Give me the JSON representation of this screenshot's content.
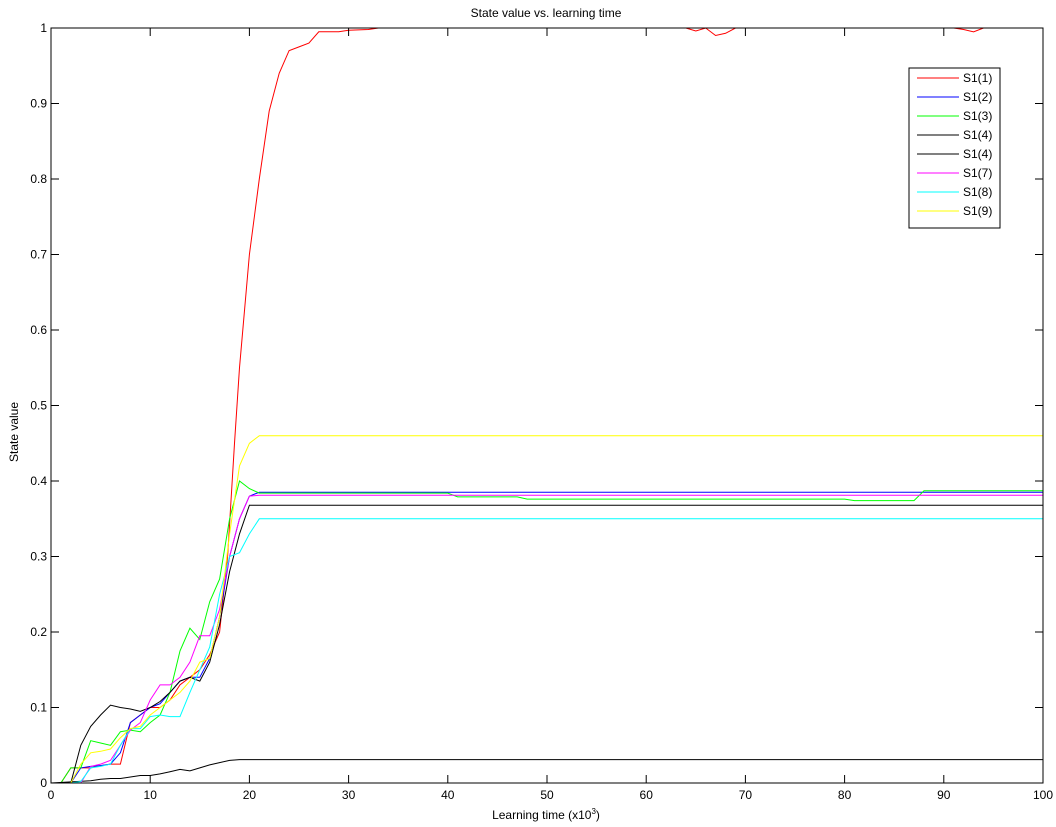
{
  "chart_data": {
    "type": "line",
    "title": "State value vs. learning time",
    "xlabel_prefix": "Learning time (x10",
    "xlabel_sup": "3",
    "xlabel_suffix": ")",
    "ylabel": "State value",
    "xlim": [
      0,
      100
    ],
    "ylim": [
      0,
      1
    ],
    "xticks": [
      0,
      10,
      20,
      30,
      40,
      50,
      60,
      70,
      80,
      90,
      100
    ],
    "yticks": [
      0,
      0.1,
      0.2,
      0.3,
      0.4,
      0.5,
      0.6,
      0.7,
      0.8,
      0.9,
      1
    ],
    "grid": false,
    "legend_position": "top-right",
    "series": [
      {
        "name": "S1(1)",
        "color": "#ff0000",
        "points": [
          [
            1,
            0
          ],
          [
            2,
            0.02
          ],
          [
            3,
            0.02
          ],
          [
            4,
            0.02
          ],
          [
            5,
            0.023
          ],
          [
            6,
            0.025
          ],
          [
            7,
            0.025
          ],
          [
            8,
            0.08
          ],
          [
            9,
            0.09
          ],
          [
            10,
            0.1
          ],
          [
            11,
            0.1
          ],
          [
            12,
            0.11
          ],
          [
            13,
            0.13
          ],
          [
            14,
            0.14
          ],
          [
            15,
            0.15
          ],
          [
            16,
            0.17
          ],
          [
            17,
            0.2
          ],
          [
            17.8,
            0.3
          ],
          [
            18.5,
            0.45
          ],
          [
            19,
            0.55
          ],
          [
            20,
            0.7
          ],
          [
            21,
            0.8
          ],
          [
            22,
            0.89
          ],
          [
            23,
            0.94
          ],
          [
            24,
            0.97
          ],
          [
            25,
            0.975
          ],
          [
            26,
            0.98
          ],
          [
            27,
            0.995
          ],
          [
            28,
            0.995
          ],
          [
            29,
            0.995
          ],
          [
            30,
            0.997
          ],
          [
            32,
            0.998
          ],
          [
            33,
            1
          ],
          [
            64,
            1
          ],
          [
            65,
            0.996
          ],
          [
            66,
            1
          ],
          [
            67,
            0.99
          ],
          [
            68,
            0.993
          ],
          [
            69,
            1
          ],
          [
            70,
            1
          ],
          [
            91,
            1
          ],
          [
            92,
            0.998
          ],
          [
            93,
            0.995
          ],
          [
            94,
            1
          ],
          [
            100,
            1
          ]
        ]
      },
      {
        "name": "S1(2)",
        "color": "#0000ff",
        "points": [
          [
            2,
            0
          ],
          [
            3,
            0.02
          ],
          [
            4,
            0.022
          ],
          [
            5,
            0.023
          ],
          [
            6,
            0.025
          ],
          [
            7,
            0.04
          ],
          [
            8,
            0.08
          ],
          [
            9,
            0.09
          ],
          [
            10,
            0.1
          ],
          [
            11,
            0.105
          ],
          [
            12,
            0.12
          ],
          [
            13,
            0.135
          ],
          [
            14,
            0.14
          ],
          [
            15,
            0.14
          ],
          [
            16,
            0.165
          ],
          [
            17,
            0.22
          ],
          [
            18,
            0.3
          ],
          [
            19,
            0.35
          ],
          [
            20,
            0.38
          ],
          [
            21,
            0.385
          ],
          [
            40,
            0.385
          ],
          [
            100,
            0.385
          ]
        ]
      },
      {
        "name": "S1(3)",
        "color": "#00ff00",
        "points": [
          [
            1,
            0
          ],
          [
            2,
            0.02
          ],
          [
            3,
            0.02
          ],
          [
            4,
            0.056
          ],
          [
            5,
            0.053
          ],
          [
            6,
            0.05
          ],
          [
            7,
            0.068
          ],
          [
            8,
            0.07
          ],
          [
            9,
            0.068
          ],
          [
            10,
            0.08
          ],
          [
            11,
            0.09
          ],
          [
            12,
            0.12
          ],
          [
            13,
            0.175
          ],
          [
            14,
            0.205
          ],
          [
            15,
            0.19
          ],
          [
            16,
            0.24
          ],
          [
            17,
            0.27
          ],
          [
            18,
            0.35
          ],
          [
            19,
            0.4
          ],
          [
            20,
            0.39
          ],
          [
            21,
            0.384
          ],
          [
            40,
            0.384
          ],
          [
            41,
            0.379
          ],
          [
            47,
            0.379
          ],
          [
            48,
            0.376
          ],
          [
            80,
            0.376
          ],
          [
            81,
            0.374
          ],
          [
            87,
            0.374
          ],
          [
            88,
            0.387
          ],
          [
            100,
            0.387
          ]
        ]
      },
      {
        "name": "S1(4)",
        "color": "#000000",
        "points": [
          [
            0,
            0
          ],
          [
            4,
            0.003
          ],
          [
            5,
            0.005
          ],
          [
            6,
            0.006
          ],
          [
            7,
            0.006
          ],
          [
            8,
            0.008
          ],
          [
            9,
            0.01
          ],
          [
            10,
            0.01
          ],
          [
            11,
            0.012
          ],
          [
            12,
            0.015
          ],
          [
            13,
            0.018
          ],
          [
            14,
            0.016
          ],
          [
            15,
            0.02
          ],
          [
            16,
            0.024
          ],
          [
            17,
            0.027
          ],
          [
            18,
            0.03
          ],
          [
            19,
            0.031
          ],
          [
            100,
            0.031
          ]
        ]
      },
      {
        "name": "S1(4)",
        "color": "#000000",
        "points": [
          [
            2,
            0
          ],
          [
            3,
            0.05
          ],
          [
            4,
            0.075
          ],
          [
            5,
            0.09
          ],
          [
            6,
            0.103
          ],
          [
            7,
            0.1
          ],
          [
            8,
            0.098
          ],
          [
            9,
            0.095
          ],
          [
            10,
            0.1
          ],
          [
            11,
            0.108
          ],
          [
            12,
            0.12
          ],
          [
            13,
            0.135
          ],
          [
            14,
            0.14
          ],
          [
            15,
            0.135
          ],
          [
            16,
            0.16
          ],
          [
            17,
            0.21
          ],
          [
            18,
            0.28
          ],
          [
            19,
            0.33
          ],
          [
            20,
            0.368
          ],
          [
            100,
            0.368
          ]
        ]
      },
      {
        "name": "S1(7)",
        "color": "#ff00ff",
        "points": [
          [
            3,
            0
          ],
          [
            4,
            0.022
          ],
          [
            5,
            0.025
          ],
          [
            6,
            0.03
          ],
          [
            7,
            0.05
          ],
          [
            8,
            0.07
          ],
          [
            9,
            0.08
          ],
          [
            10,
            0.11
          ],
          [
            11,
            0.13
          ],
          [
            12,
            0.13
          ],
          [
            13,
            0.14
          ],
          [
            14,
            0.16
          ],
          [
            15,
            0.195
          ],
          [
            16,
            0.195
          ],
          [
            17,
            0.23
          ],
          [
            18,
            0.3
          ],
          [
            19,
            0.35
          ],
          [
            20,
            0.38
          ],
          [
            21,
            0.381
          ],
          [
            40,
            0.381
          ],
          [
            100,
            0.381
          ]
        ]
      },
      {
        "name": "S1(8)",
        "color": "#00ffff",
        "points": [
          [
            2,
            0
          ],
          [
            3,
            0.002
          ],
          [
            4,
            0.02
          ],
          [
            5,
            0.022
          ],
          [
            6,
            0.025
          ],
          [
            7,
            0.05
          ],
          [
            8,
            0.072
          ],
          [
            9,
            0.072
          ],
          [
            10,
            0.088
          ],
          [
            11,
            0.09
          ],
          [
            12,
            0.088
          ],
          [
            13,
            0.088
          ],
          [
            14,
            0.12
          ],
          [
            15,
            0.15
          ],
          [
            16,
            0.18
          ],
          [
            17,
            0.25
          ],
          [
            18,
            0.3
          ],
          [
            19,
            0.305
          ],
          [
            20,
            0.33
          ],
          [
            21,
            0.35
          ],
          [
            100,
            0.35
          ]
        ]
      },
      {
        "name": "S1(9)",
        "color": "#ffff00",
        "points": [
          [
            2,
            0
          ],
          [
            3,
            0.025
          ],
          [
            4,
            0.04
          ],
          [
            5,
            0.042
          ],
          [
            6,
            0.045
          ],
          [
            7,
            0.06
          ],
          [
            8,
            0.072
          ],
          [
            9,
            0.075
          ],
          [
            10,
            0.09
          ],
          [
            11,
            0.1
          ],
          [
            12,
            0.11
          ],
          [
            13,
            0.12
          ],
          [
            14,
            0.135
          ],
          [
            15,
            0.16
          ],
          [
            16,
            0.165
          ],
          [
            17,
            0.22
          ],
          [
            18,
            0.33
          ],
          [
            19,
            0.42
          ],
          [
            20,
            0.45
          ],
          [
            21,
            0.46
          ],
          [
            100,
            0.46
          ]
        ]
      }
    ]
  }
}
